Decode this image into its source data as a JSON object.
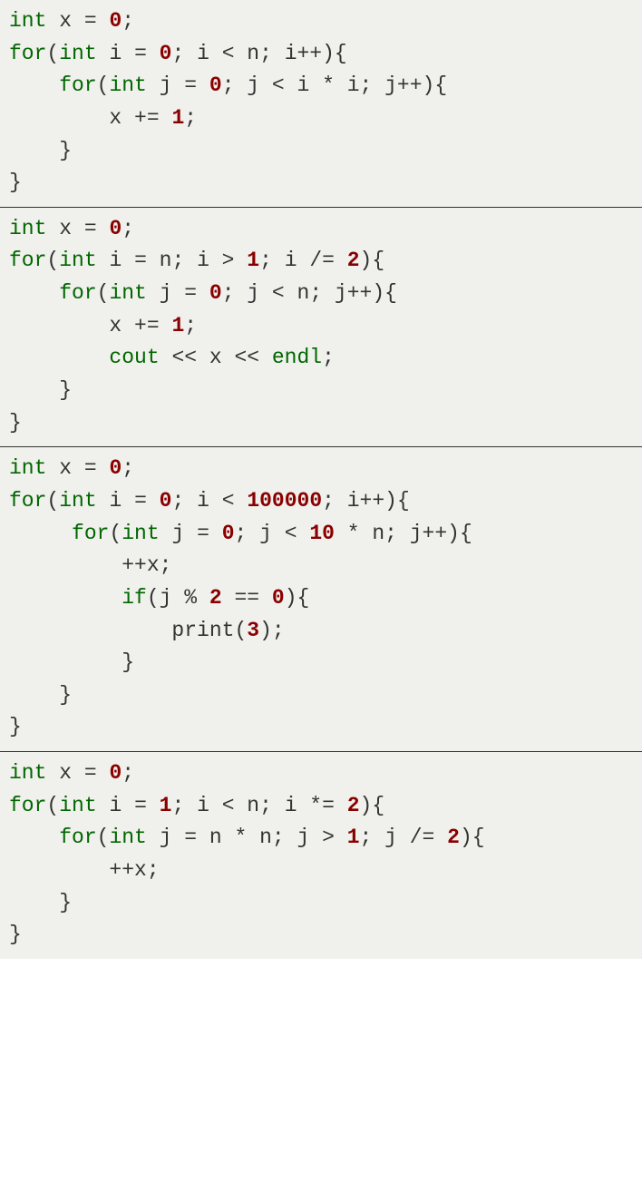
{
  "blocks": [
    {
      "tokens": [
        [
          {
            "t": "int",
            "c": "kw"
          },
          {
            "t": " x = "
          },
          {
            "t": "0",
            "c": "num"
          },
          {
            "t": ";"
          }
        ],
        [
          {
            "t": "for",
            "c": "kw"
          },
          {
            "t": "("
          },
          {
            "t": "int",
            "c": "kw"
          },
          {
            "t": " i = "
          },
          {
            "t": "0",
            "c": "num"
          },
          {
            "t": "; i < n; i++){"
          }
        ],
        [
          {
            "t": "    "
          },
          {
            "t": "for",
            "c": "kw"
          },
          {
            "t": "("
          },
          {
            "t": "int",
            "c": "kw"
          },
          {
            "t": " j = "
          },
          {
            "t": "0",
            "c": "num"
          },
          {
            "t": "; j < i * i; j++){"
          }
        ],
        [
          {
            "t": "        x += "
          },
          {
            "t": "1",
            "c": "num"
          },
          {
            "t": ";"
          }
        ],
        [
          {
            "t": "    }"
          }
        ],
        [
          {
            "t": "}"
          }
        ]
      ]
    },
    {
      "tokens": [
        [
          {
            "t": "int",
            "c": "kw"
          },
          {
            "t": " x = "
          },
          {
            "t": "0",
            "c": "num"
          },
          {
            "t": ";"
          }
        ],
        [
          {
            "t": "for",
            "c": "kw"
          },
          {
            "t": "("
          },
          {
            "t": "int",
            "c": "kw"
          },
          {
            "t": " i = n; i > "
          },
          {
            "t": "1",
            "c": "num"
          },
          {
            "t": "; i /= "
          },
          {
            "t": "2",
            "c": "num"
          },
          {
            "t": "){"
          }
        ],
        [
          {
            "t": "    "
          },
          {
            "t": "for",
            "c": "kw"
          },
          {
            "t": "("
          },
          {
            "t": "int",
            "c": "kw"
          },
          {
            "t": " j = "
          },
          {
            "t": "0",
            "c": "num"
          },
          {
            "t": "; j < n; j++){"
          }
        ],
        [
          {
            "t": "        x += "
          },
          {
            "t": "1",
            "c": "num"
          },
          {
            "t": ";"
          }
        ],
        [
          {
            "t": "        "
          },
          {
            "t": "cout",
            "c": "kw"
          },
          {
            "t": " << x << "
          },
          {
            "t": "endl",
            "c": "kw"
          },
          {
            "t": ";"
          }
        ],
        [
          {
            "t": "    }"
          }
        ],
        [
          {
            "t": "}"
          }
        ]
      ]
    },
    {
      "tokens": [
        [
          {
            "t": "int",
            "c": "kw"
          },
          {
            "t": " x = "
          },
          {
            "t": "0",
            "c": "num"
          },
          {
            "t": ";"
          }
        ],
        [
          {
            "t": "for",
            "c": "kw"
          },
          {
            "t": "("
          },
          {
            "t": "int",
            "c": "kw"
          },
          {
            "t": " i = "
          },
          {
            "t": "0",
            "c": "num"
          },
          {
            "t": "; i < "
          },
          {
            "t": "100000",
            "c": "num"
          },
          {
            "t": "; i++){"
          }
        ],
        [
          {
            "t": "     "
          },
          {
            "t": "for",
            "c": "kw"
          },
          {
            "t": "("
          },
          {
            "t": "int",
            "c": "kw"
          },
          {
            "t": " j = "
          },
          {
            "t": "0",
            "c": "num"
          },
          {
            "t": "; j < "
          },
          {
            "t": "10",
            "c": "num"
          },
          {
            "t": " * n; j++){"
          }
        ],
        [
          {
            "t": "         ++x;"
          }
        ],
        [
          {
            "t": "         "
          },
          {
            "t": "if",
            "c": "kw"
          },
          {
            "t": "(j % "
          },
          {
            "t": "2",
            "c": "num"
          },
          {
            "t": " == "
          },
          {
            "t": "0",
            "c": "num"
          },
          {
            "t": "){"
          }
        ],
        [
          {
            "t": "             print("
          },
          {
            "t": "3",
            "c": "num"
          },
          {
            "t": ");"
          }
        ],
        [
          {
            "t": "         }"
          }
        ],
        [
          {
            "t": "    }"
          }
        ],
        [
          {
            "t": "}"
          }
        ]
      ]
    },
    {
      "tokens": [
        [
          {
            "t": "int",
            "c": "kw"
          },
          {
            "t": " x = "
          },
          {
            "t": "0",
            "c": "num"
          },
          {
            "t": ";"
          }
        ],
        [
          {
            "t": "for",
            "c": "kw"
          },
          {
            "t": "("
          },
          {
            "t": "int",
            "c": "kw"
          },
          {
            "t": " i = "
          },
          {
            "t": "1",
            "c": "num"
          },
          {
            "t": "; i < n; i *= "
          },
          {
            "t": "2",
            "c": "num"
          },
          {
            "t": "){"
          }
        ],
        [
          {
            "t": "    "
          },
          {
            "t": "for",
            "c": "kw"
          },
          {
            "t": "("
          },
          {
            "t": "int",
            "c": "kw"
          },
          {
            "t": " j = n * n; j > "
          },
          {
            "t": "1",
            "c": "num"
          },
          {
            "t": "; j /= "
          },
          {
            "t": "2",
            "c": "num"
          },
          {
            "t": "){"
          }
        ],
        [
          {
            "t": "        ++x;"
          }
        ],
        [
          {
            "t": "    }"
          }
        ],
        [
          {
            "t": "}"
          }
        ]
      ]
    }
  ]
}
